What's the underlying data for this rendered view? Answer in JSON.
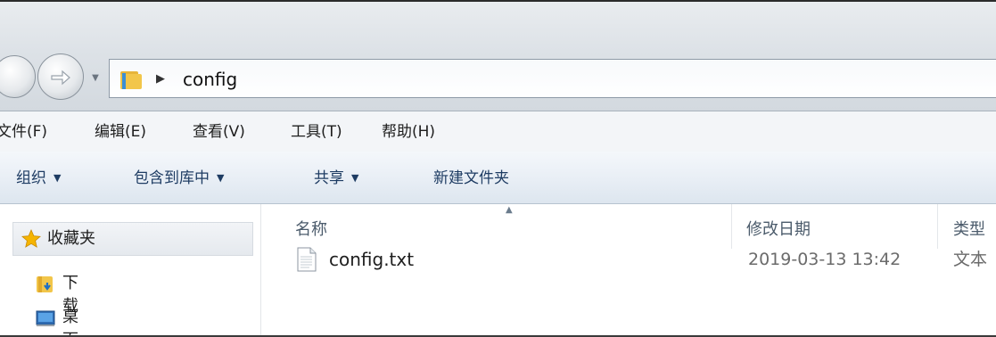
{
  "address": {
    "path_segment": "config"
  },
  "menubar": {
    "items": [
      {
        "label": "文件(F)"
      },
      {
        "label": "编辑(E)"
      },
      {
        "label": "查看(V)"
      },
      {
        "label": "工具(T)"
      },
      {
        "label": "帮助(H)"
      }
    ]
  },
  "toolbar": {
    "organize": "组织",
    "include_in_library": "包含到库中",
    "share": "共享",
    "new_folder": "新建文件夹"
  },
  "navpane": {
    "favorites": "收藏夹",
    "downloads": "下载",
    "desktop": "桌面"
  },
  "columns": {
    "name": "名称",
    "modified": "修改日期",
    "type": "类型"
  },
  "files": [
    {
      "name": "config.txt",
      "modified": "2019-03-13 13:42",
      "type": "文本"
    }
  ],
  "colors": {
    "toolbar_text": "#1e3c63",
    "column_header_text": "#4b5b6b",
    "folder_yellow": "#f2c64a",
    "favorites_star": "#f5b400"
  }
}
